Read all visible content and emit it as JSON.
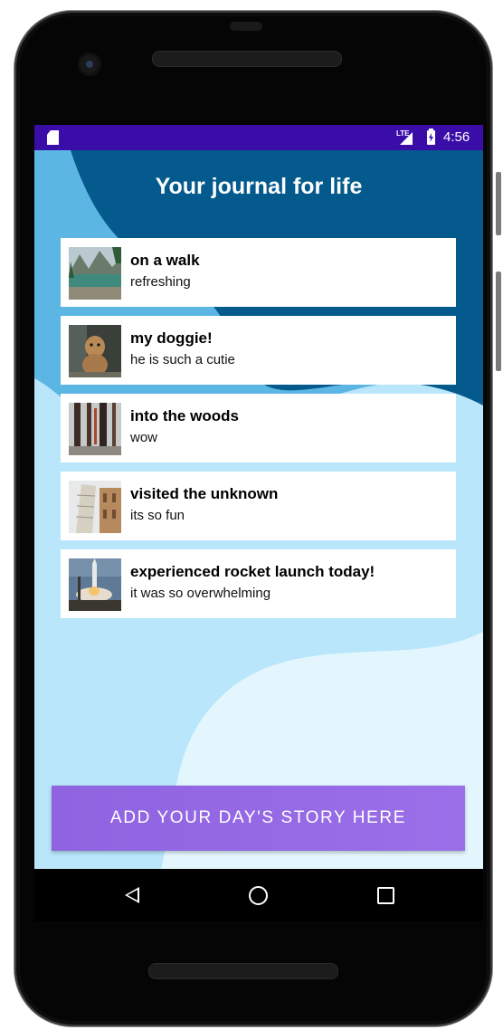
{
  "status_bar": {
    "time": "4:56",
    "network": "LTE",
    "icons": [
      "sd-card-icon",
      "signal-icon",
      "battery-charging-icon"
    ]
  },
  "app": {
    "title": "Your journal for life",
    "entries": [
      {
        "title": "on a walk",
        "subtitle": "refreshing",
        "thumbnail": "lake-mountains-photo"
      },
      {
        "title": "my doggie!",
        "subtitle": "he is such a cutie",
        "thumbnail": "dog-photo"
      },
      {
        "title": "into the woods",
        "subtitle": "wow",
        "thumbnail": "forest-photo"
      },
      {
        "title": "visited the unknown",
        "subtitle": "its so fun",
        "thumbnail": "leaning-tower-photo"
      },
      {
        "title": "experienced rocket launch today!",
        "subtitle": "it was so overwhelming",
        "thumbnail": "rocket-launch-photo"
      }
    ],
    "add_button_label": "ADD YOUR DAY'S STORY HERE"
  },
  "nav_bar": {
    "buttons": [
      "back",
      "home",
      "recents"
    ]
  },
  "colors": {
    "status_bar": "#3a0ca8",
    "header_dark_blue": "#045a8d",
    "mid_blue": "#5cb6e3",
    "light_blue": "#b9e6fa",
    "pale_blue": "#e3f6fd",
    "button_purple": "#9367e4"
  }
}
